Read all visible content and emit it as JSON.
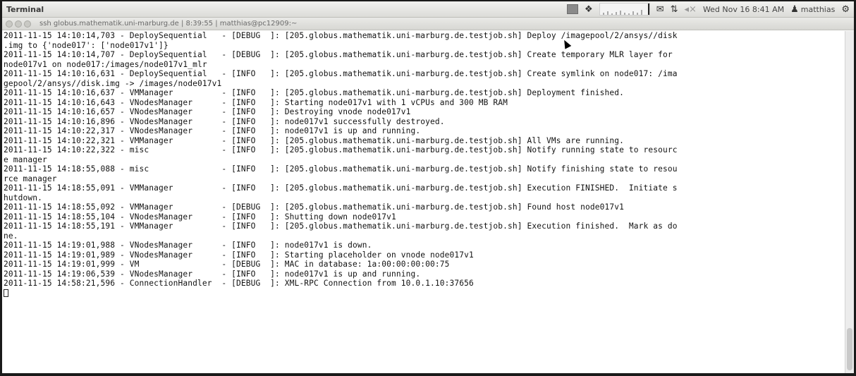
{
  "panel": {
    "app_title": "Terminal",
    "clock": "Wed Nov 16  8:41 AM",
    "user": "matthias",
    "icons": [
      "window-icon",
      "dropbox-icon",
      "system-monitor-icon",
      "mail-icon",
      "network-icon",
      "volume-icon",
      "user-icon",
      "gear-icon"
    ]
  },
  "window": {
    "title": "ssh globus.mathematik.uni-marburg.de | 8:39:55 | matthias@pc12909:~"
  },
  "log_lines": [
    "2011-11-15 14:10:14,703 - DeploySequential   - [DEBUG  ]: [205.globus.mathematik.uni-marburg.de.testjob.sh] Deploy /imagepool/2/ansys//disk",
    ".img to {'node017': ['node017v1']}",
    "2011-11-15 14:10:14,707 - DeploySequential   - [DEBUG  ]: [205.globus.mathematik.uni-marburg.de.testjob.sh] Create temporary MLR layer for",
    "node017v1 on node017:/images/node017v1_mlr",
    "2011-11-15 14:10:16,631 - DeploySequential   - [INFO   ]: [205.globus.mathematik.uni-marburg.de.testjob.sh] Create symlink on node017: /ima",
    "gepool/2/ansys//disk.img -> /images/node017v1",
    "2011-11-15 14:10:16,637 - VMManager          - [INFO   ]: [205.globus.mathematik.uni-marburg.de.testjob.sh] Deployment finished.",
    "2011-11-15 14:10:16,643 - VNodesManager      - [INFO   ]: Starting node017v1 with 1 vCPUs and 300 MB RAM",
    "2011-11-15 14:10:16,657 - VNodesManager      - [INFO   ]: Destroying vnode node017v1",
    "2011-11-15 14:10:16,896 - VNodesManager      - [INFO   ]: node017v1 successfully destroyed.",
    "2011-11-15 14:10:22,317 - VNodesManager      - [INFO   ]: node017v1 is up and running.",
    "2011-11-15 14:10:22,321 - VMManager          - [INFO   ]: [205.globus.mathematik.uni-marburg.de.testjob.sh] All VMs are running.",
    "2011-11-15 14:10:22,322 - misc               - [INFO   ]: [205.globus.mathematik.uni-marburg.de.testjob.sh] Notify running state to resourc",
    "e manager",
    "2011-11-15 14:18:55,088 - misc               - [INFO   ]: [205.globus.mathematik.uni-marburg.de.testjob.sh] Notify finishing state to resou",
    "rce manager",
    "2011-11-15 14:18:55,091 - VMManager          - [INFO   ]: [205.globus.mathematik.uni-marburg.de.testjob.sh] Execution FINISHED.  Initiate s",
    "hutdown.",
    "2011-11-15 14:18:55,092 - VMManager          - [DEBUG  ]: [205.globus.mathematik.uni-marburg.de.testjob.sh] Found host node017v1",
    "2011-11-15 14:18:55,104 - VNodesManager      - [INFO   ]: Shutting down node017v1",
    "2011-11-15 14:18:55,191 - VMManager          - [INFO   ]: [205.globus.mathematik.uni-marburg.de.testjob.sh] Execution finished.  Mark as do",
    "ne.",
    "2011-11-15 14:19:01,988 - VNodesManager      - [INFO   ]: node017v1 is down.",
    "2011-11-15 14:19:01,989 - VNodesManager      - [INFO   ]: Starting placeholder on vnode node017v1",
    "2011-11-15 14:19:01,999 - VM                 - [DEBUG  ]: MAC in database: 1a:00:00:00:00:75",
    "2011-11-15 14:19:06,539 - VNodesManager      - [INFO   ]: node017v1 is up and running.",
    "2011-11-15 14:58:21,596 - ConnectionHandler  - [DEBUG  ]: XML-RPC Connection from 10.0.1.10:37656"
  ]
}
